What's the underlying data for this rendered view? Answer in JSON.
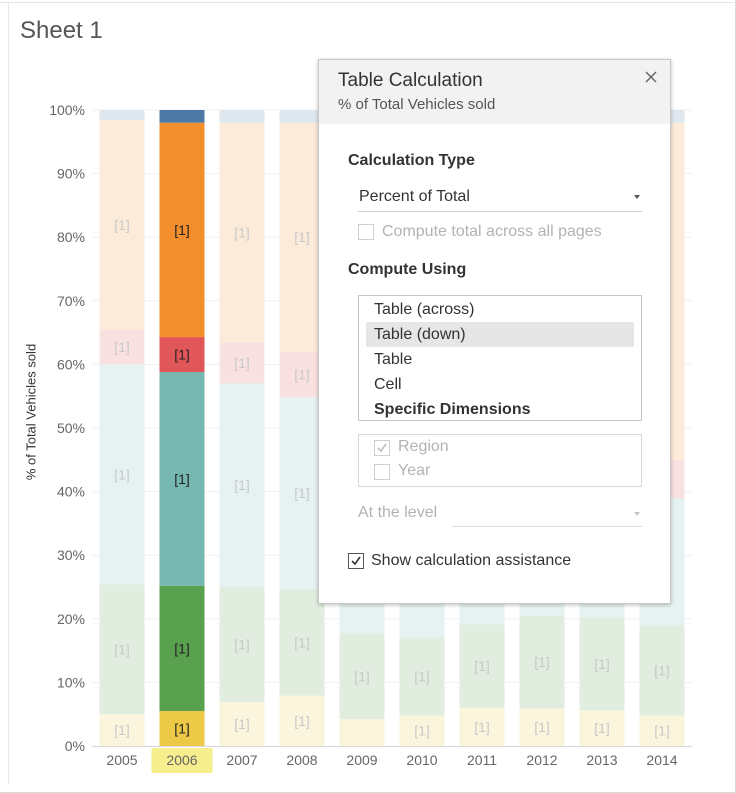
{
  "sheet": {
    "title": "Sheet 1"
  },
  "chart_data": {
    "type": "bar",
    "stacked": true,
    "categories": [
      "2005",
      "2006",
      "2007",
      "2008",
      "2009",
      "2010",
      "2011",
      "2012",
      "2013",
      "2014"
    ],
    "highlighted_category": "2006",
    "ylabel": "% of Total Vehicles sold",
    "ylim": [
      0,
      100
    ],
    "y_ticks": [
      "0%",
      "10%",
      "20%",
      "30%",
      "40%",
      "50%",
      "60%",
      "70%",
      "80%",
      "90%",
      "100%"
    ],
    "segment_label": "[1]",
    "series": [
      {
        "name": "",
        "color": "#edc948",
        "values": [
          5.0,
          5.5,
          6.9,
          7.9,
          4.2,
          4.8,
          6.0,
          5.9,
          5.6,
          4.8
        ]
      },
      {
        "name": "",
        "color": "#59a14f",
        "values": [
          20.4,
          19.7,
          18.1,
          16.8,
          13.5,
          12.3,
          13.1,
          14.6,
          14.6,
          14.2
        ]
      },
      {
        "name": "",
        "color": "#76b7b2",
        "values": [
          34.6,
          33.6,
          32.0,
          30.1,
          24.3,
          22.7,
          22.9,
          22.5,
          22.3,
          20.0
        ]
      },
      {
        "name": "",
        "color": "#e15759",
        "values": [
          5.5,
          5.5,
          6.4,
          7.2,
          7.1,
          6.9,
          7.2,
          6.9,
          7.0,
          6.0
        ]
      },
      {
        "name": "",
        "color": "#f28e2b",
        "values": [
          32.9,
          33.7,
          34.6,
          36.0,
          48.9,
          51.3,
          48.8,
          48.1,
          48.5,
          53.0
        ]
      },
      {
        "name": "",
        "color": "#4e79a7",
        "values": [
          1.6,
          2.0,
          2.0,
          2.0,
          2.0,
          2.0,
          2.0,
          2.0,
          2.0,
          2.0
        ]
      }
    ]
  },
  "dialog": {
    "title": "Table Calculation",
    "subtitle": "% of Total Vehicles sold",
    "calc_type_heading": "Calculation Type",
    "calc_type_value": "Percent of Total",
    "compute_total_label": "Compute total across all pages",
    "compute_total_checked": false,
    "compute_using_heading": "Compute Using",
    "compute_using_options": [
      "Table (across)",
      "Table (down)",
      "Table",
      "Cell",
      "Specific Dimensions"
    ],
    "compute_using_selected": "Table (down)",
    "dimensions": [
      {
        "label": "Region",
        "checked": true
      },
      {
        "label": "Year",
        "checked": false
      }
    ],
    "at_level_label": "At the level",
    "at_level_value": "",
    "show_assist_label": "Show calculation assistance",
    "show_assist_checked": true
  }
}
